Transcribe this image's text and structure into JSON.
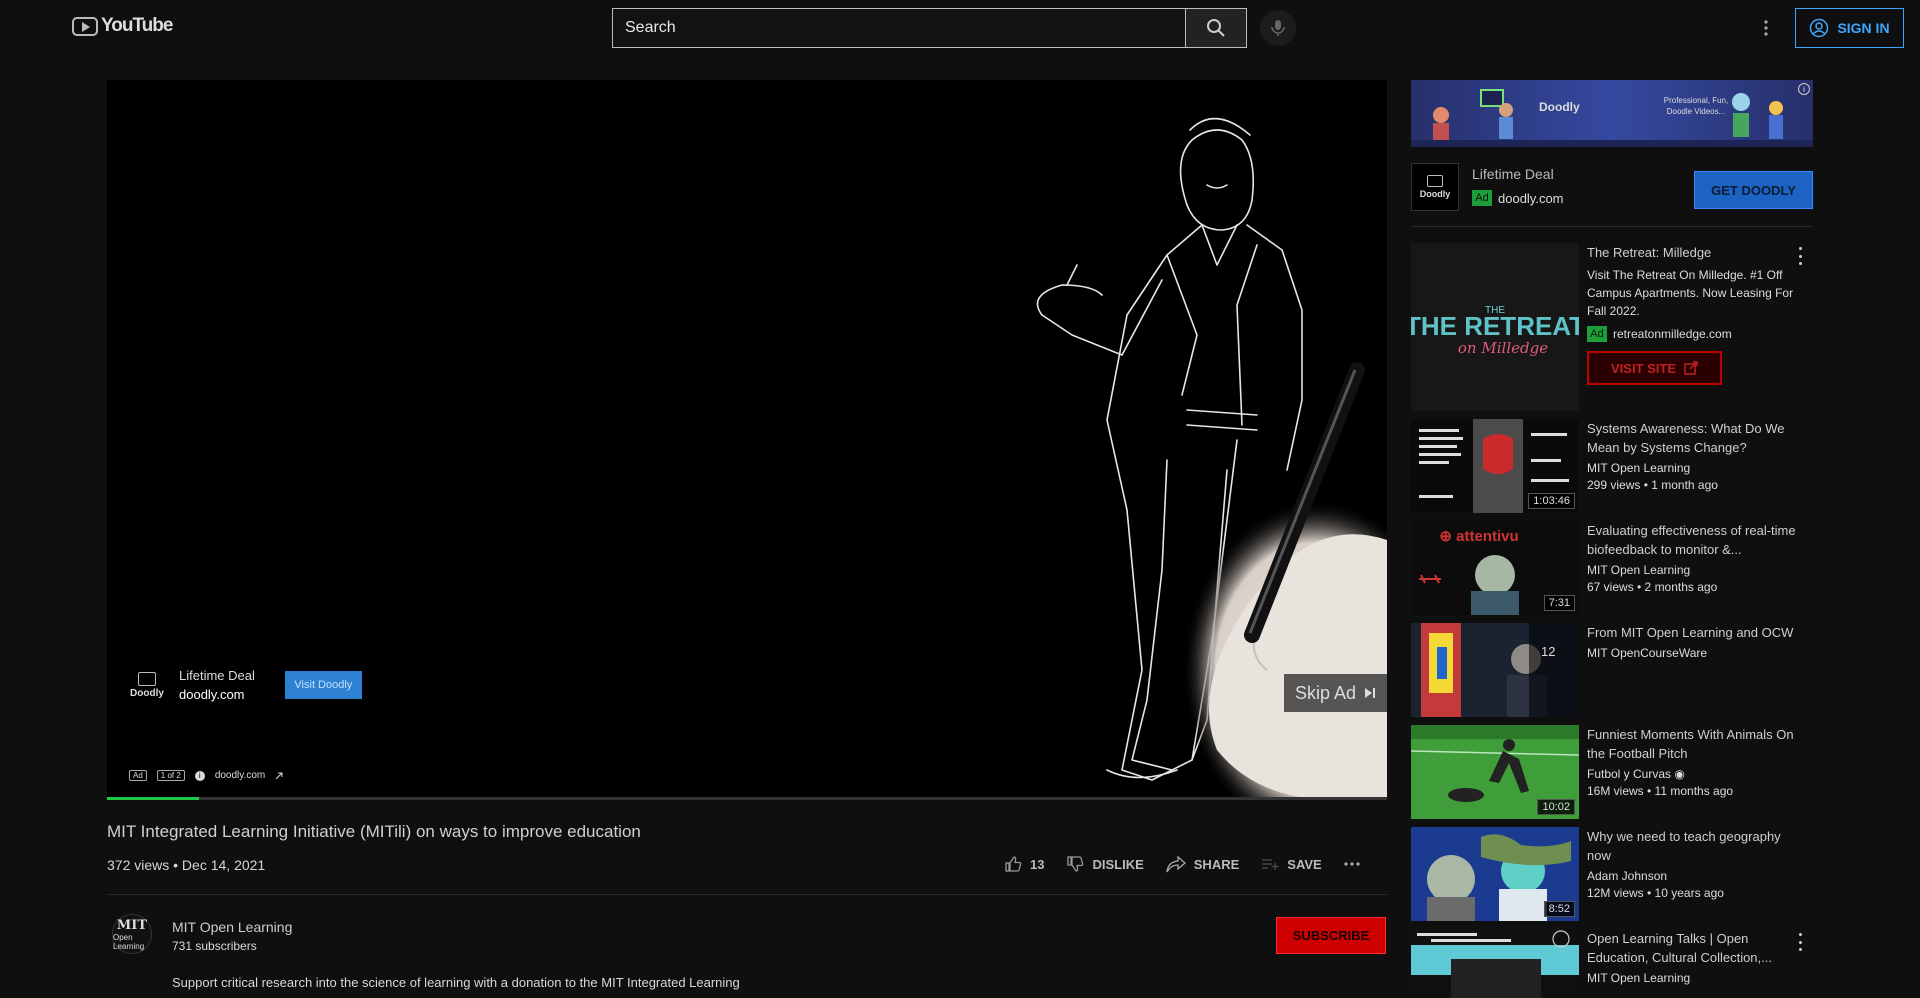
{
  "header": {
    "logo_text": "YouTube",
    "search_placeholder": "Search",
    "sign_in_label": "SIGN IN"
  },
  "player": {
    "skip_ad_label": "Skip Ad",
    "progress_fraction": 0.072,
    "overlay": {
      "title": "Lifetime Deal",
      "url": "doodly.com",
      "visit_label": "Visit Doodly",
      "logo_text": "Doodly"
    },
    "ad_strip": {
      "ad_chip": "Ad",
      "counter": "1 of 2",
      "info": "i",
      "domain": "doodly.com"
    }
  },
  "video": {
    "title": "MIT Integrated Learning Initiative (MITili) on ways to improve education",
    "meta": "372 views • Dec 14, 2021",
    "like_count": "13",
    "dislike_label": "DISLIKE",
    "share_label": "SHARE",
    "save_label": "SAVE"
  },
  "channel": {
    "name": "MIT Open Learning",
    "subscribers": "731 subscribers",
    "subscribe_label": "SUBSCRIBE",
    "avatar_logo": "MIT",
    "avatar_sub": "Open Learning",
    "description": "Support critical research into the science of learning with a donation to the MIT Integrated Learning"
  },
  "sidebar": {
    "banner_ad": {
      "brand": "Doodly",
      "tagline": "Professional, Fun, Doodle Videos...",
      "info": "i"
    },
    "ad_card": {
      "title": "Lifetime Deal",
      "ad_badge": "Ad",
      "url": "doodly.com",
      "cta_label": "GET DOODLY",
      "logo_text": "Doodly"
    },
    "promoted": {
      "title": "The Retreat: Milledge",
      "description": "Visit The Retreat On Milledge. #1 Off Campus Apartments. Now Leasing For Fall 2022.",
      "ad_badge": "Ad",
      "url": "retreatonmilledge.com",
      "cta_label": "VISIT SITE",
      "thumb_title": "THE RETREAT",
      "thumb_sub": "on Milledge"
    },
    "videos": [
      {
        "title": "Systems Awareness: What Do We Mean by Systems Change?",
        "channel": "MIT Open Learning",
        "meta": "299 views • 1 month ago",
        "duration": "1:03:46"
      },
      {
        "title": "Evaluating effectiveness of real-time biofeedback to monitor &...",
        "channel": "MIT Open Learning",
        "meta": "67 views • 2 months ago",
        "duration": "7:31"
      },
      {
        "title": "From MIT Open Learning and OCW",
        "channel": "MIT OpenCourseWare",
        "meta": "",
        "duration": "12"
      },
      {
        "title": "Funniest Moments With Animals On the Football Pitch",
        "channel": "Futbol y Curvas",
        "meta": "16M views • 11 months ago",
        "duration": "10:02"
      },
      {
        "title": "Why we need to teach geography now",
        "channel": "Adam Johnson",
        "meta": "12M views • 10 years ago",
        "duration": "8:52"
      },
      {
        "title": "Open Learning Talks | Open Education, Cultural Collection,...",
        "channel": "MIT Open Learning",
        "meta": "",
        "duration": ""
      }
    ]
  },
  "colors": {
    "background": "#0f0f0f",
    "accent_blue": "#3ea6ff",
    "subscribe_red": "#cc0000",
    "ad_green": "#1e9e3a",
    "progress_green": "#1ec94a"
  }
}
